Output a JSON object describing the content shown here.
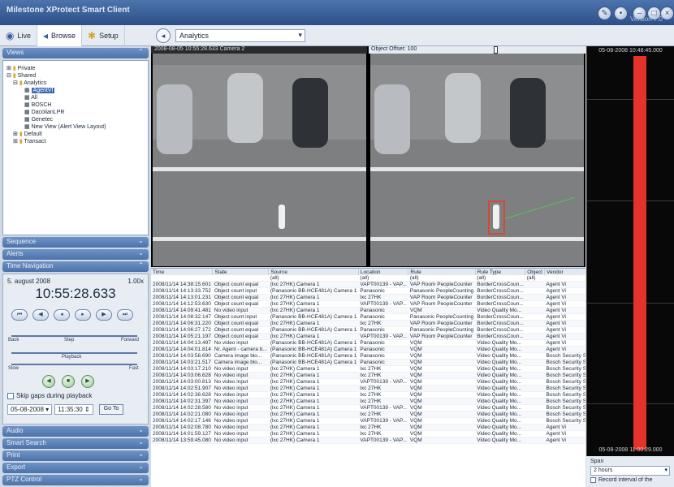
{
  "window": {
    "title": "Milestone XProtect Smart Client",
    "version": "Version 7.0"
  },
  "tabs": [
    {
      "label": "Live",
      "icon": "camera-icon"
    },
    {
      "label": "Browse",
      "icon": "browse-icon"
    },
    {
      "label": "Setup",
      "icon": "setup-icon"
    }
  ],
  "view_selector": {
    "value": "Analytics"
  },
  "panels": {
    "views": "Views",
    "sequence": "Sequence",
    "alerts": "Alerts",
    "time_navigation": "Time Navigation",
    "audio": "Audio",
    "smart_search": "Smart Search",
    "print": "Print",
    "export": "Export",
    "ptz": "PTZ Control"
  },
  "tree": {
    "private": "Private",
    "shared": "Shared",
    "analytics": "Analytics",
    "items": [
      "AgentVI",
      "All",
      "BOSCH",
      "DacolianLPR",
      "Genetec",
      "New View (Alert View Layout)"
    ],
    "default": "Default",
    "transact": "Transact"
  },
  "time_nav": {
    "date": "5. august 2008",
    "speed": "1.00x",
    "time": "10:55:28.633",
    "labels": {
      "back": "Back",
      "forward": "Forward",
      "slow": "Slow",
      "fast": "Fast",
      "step": "Step",
      "playback": "Playback"
    },
    "skip_gaps": "Skip gaps during playback",
    "date_field": "05-08-2008",
    "time_field": "11:35:30",
    "goto": "Go To"
  },
  "video": {
    "camera_header": "2008-08-05 10:55:28.633 Camera 2",
    "offset_label": "Object Offset: 100",
    "offset_value": 0.58
  },
  "table": {
    "columns": [
      "Time",
      "State",
      "Source",
      "Location",
      "Rule",
      "Rule Type",
      "Object",
      "Vendor"
    ],
    "filter": [
      "",
      "",
      "(all)",
      "(all)",
      "(all)",
      "(all)",
      "(all)",
      ""
    ],
    "rows": [
      [
        "2008/11/14 14:38:15.601",
        "Object count equal",
        "(lxc 27HK) Camera 1",
        "VAPT00139 - VAP...",
        "VAP Room PeopleCounter",
        "BorderCrossCoun...",
        "",
        "Agent Vi"
      ],
      [
        "2008/11/14 14:13:33.752",
        "Object count input",
        "(Panasonic BB-HCE481A) Camera 1",
        "Panasonic",
        "Panasonic PeopleCounting",
        "BorderCrossCoun...",
        "",
        "Agent Vi"
      ],
      [
        "2008/11/14 14:13:01.231",
        "Object count equal",
        "(lxc 27HK) Camera 1",
        "lxc 27HK",
        "VAP Room PeopleCounter",
        "BorderCrossCoun...",
        "",
        "Agent Vi"
      ],
      [
        "2008/11/14 14:12:53.630",
        "Object count equal",
        "(lxc 27HK) Camera 1",
        "VAPT00139 - VAP...",
        "VAP Room PeopleCounter",
        "BorderCrossCoun...",
        "",
        "Agent Vi"
      ],
      [
        "2008/11/14 14:09:41.481",
        "No video input",
        "(lxc 27HK) Camera 1",
        "Panasonic",
        "VQM",
        "Video Quality Mo...",
        "",
        "Agent Vi"
      ],
      [
        "2008/11/14 14:08:32.147",
        "Object count input",
        "(Panasonic BB-HCE481A) Camera 1",
        "Panasonic",
        "Panasonic PeopleCounting",
        "BorderCrossCoun...",
        "",
        "Agent Vi"
      ],
      [
        "2008/11/14 14:06:31.220",
        "Object count equal",
        "(lxc 27HK) Camera 1",
        "lxc 27HK",
        "VAP Room PeopleCounter",
        "BorderCrossCoun...",
        "",
        "Agent Vi"
      ],
      [
        "2008/11/14 14:06:27.172",
        "Object count equal",
        "(Panasonic BB-HCE481A) Camera 1",
        "Panasonic",
        "Panasonic PeopleCounting",
        "BorderCrossCoun...",
        "",
        "Agent Vi"
      ],
      [
        "2008/11/14 14:05:21.197",
        "Object count equal",
        "(lxc 27HK) Camera 1",
        "VAPT00139 - VAP...",
        "VAP Room PeopleCounter",
        "BorderCrossCoun...",
        "",
        "Agent Vi"
      ],
      [
        "2008/11/14 14:04:13.497",
        "No video input",
        "(Panasonic BB-HCE481A) Camera 1",
        "Panasonic",
        "VQM",
        "Video Quality Mo...",
        "",
        "Agent Vi"
      ],
      [
        "2008/11/14 14:04:01.814",
        "Nr. Agent - camera b...",
        "(Panasonic BB-HCE481A) Camera 1",
        "Panasonic",
        "VQM",
        "Video Quality Mo...",
        "",
        "Agent Vi"
      ],
      [
        "2008/11/14 14:03:58.690",
        "Camera image blo...",
        "(Panasonic BB-HCE481A) Camera 1",
        "Panasonic",
        "VQM",
        "Video Quality Mo...",
        "",
        "Bosch Security Syst..."
      ],
      [
        "2008/11/14 14:03:21.517",
        "Camera image blo...",
        "(Panasonic BB-HCE481A) Camera 1",
        "Panasonic",
        "VQM",
        "Video Quality Mo...",
        "",
        "Bosch Security Syst..."
      ],
      [
        "2008/11/14 14:03:17.210",
        "No video input",
        "(lxc 27HK) Camera 1",
        "lxc 27HK",
        "VQM",
        "Video Quality Mo...",
        "",
        "Bosch Security Syst..."
      ],
      [
        "2008/11/14 14:03:06.628",
        "No video input",
        "(lxc 27HK) Camera 1",
        "lxc 27HK",
        "VQM",
        "Video Quality Mo...",
        "",
        "Bosch Security Syst..."
      ],
      [
        "2008/11/14 14:03:00.813",
        "No video input",
        "(lxc 27HK) Camera 1",
        "VAPT00139 - VAP...",
        "VQM",
        "Video Quality Mo...",
        "",
        "Bosch Security Syst..."
      ],
      [
        "2008/11/14 14:02:51.907",
        "No video input",
        "(lxc 27HK) Camera 1",
        "lxc 27HK",
        "VQM",
        "Video Quality Mo...",
        "",
        "Bosch Security Syst..."
      ],
      [
        "2008/11/14 14:02:38.628",
        "No video input",
        "(lxc 27HK) Camera 1",
        "lxc 27HK",
        "VQM",
        "Video Quality Mo...",
        "",
        "Bosch Security Syst..."
      ],
      [
        "2008/11/14 14:02:31.397",
        "No video input",
        "(lxc 27HK) Camera 1",
        "lxc 27HK",
        "VQM",
        "Video Quality Mo...",
        "",
        "Bosch Security Syst..."
      ],
      [
        "2008/11/14 14:02:28.580",
        "No video input",
        "(lxc 27HK) Camera 1",
        "VAPT00139 - VAP...",
        "VQM",
        "Video Quality Mo...",
        "",
        "Bosch Security Syst..."
      ],
      [
        "2008/11/14 14:02:21.080",
        "No video input",
        "(lxc 27HK) Camera 1",
        "lxc 27HK",
        "VQM",
        "Video Quality Mo...",
        "",
        "Bosch Security Syst..."
      ],
      [
        "2008/11/14 14:02:17.146",
        "No video input",
        "(lxc 27HK) Camera 1",
        "VAPT00139 - VAP...",
        "VQM",
        "Video Quality Mo...",
        "",
        "Bosch Security Syst..."
      ],
      [
        "2008/11/14 14:02:08.780",
        "No video input",
        "(lxc 27HK) Camera 1",
        "lxc 27HK",
        "VQM",
        "Video Quality Mo...",
        "",
        "Agent Vi"
      ],
      [
        "2008/11/14 14:01:59.127",
        "No video input",
        "(lxc 27HK) Camera 1",
        "lxc 27HK",
        "VQM",
        "Video Quality Mo...",
        "",
        "Agent Vi"
      ],
      [
        "2008/11/14 13:59:45.080",
        "No video input",
        "(lxc 27HK) Camera 1",
        "VAPT00139 - VAP...",
        "VQM",
        "Video Quality Mo...",
        "",
        "Agent Vi"
      ]
    ]
  },
  "timeline": {
    "top_label": "05-08-2008 10:48:45.000",
    "bottom_label": "05-08-2008 11:00:29.000"
  },
  "span": {
    "label": "Span",
    "value": "2 hours",
    "checkbox": "Record interval of the"
  },
  "colors": {
    "accent": "#3d68b0",
    "alert_bar": "#e5322a",
    "box": "#d44a2f"
  }
}
